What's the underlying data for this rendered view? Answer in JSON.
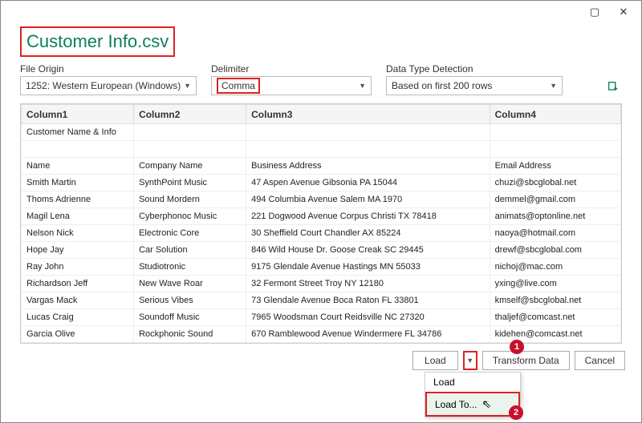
{
  "title": "Customer Info.csv",
  "controls": {
    "fileOrigin": {
      "label": "File Origin",
      "value": "1252: Western European (Windows)"
    },
    "delimiter": {
      "label": "Delimiter",
      "value": "Comma"
    },
    "detection": {
      "label": "Data Type Detection",
      "value": "Based on first 200 rows"
    }
  },
  "columns": [
    "Column1",
    "Column2",
    "Column3",
    "Column4"
  ],
  "rows": [
    [
      "Customer Name & Info",
      "",
      "",
      ""
    ],
    [
      "",
      "",
      "",
      ""
    ],
    [
      "Name",
      "Company Name",
      "Business Address",
      "Email Address"
    ],
    [
      "Smith Martin",
      "SynthPoint Music",
      "47 Aspen Avenue Gibsonia PA 15044",
      "chuzi@sbcglobal.net"
    ],
    [
      "Thoms Adrienne",
      "Sound Mordern",
      "494 Columbia Avenue Salem MA 1970",
      "demmel@gmail.com"
    ],
    [
      "Magil Lena",
      "Cyberphonoc Music",
      "221 Dogwood Avenue Corpus Christi TX 78418",
      "animats@optonline.net"
    ],
    [
      "Nelson Nick",
      "Electronic Core",
      "30 Sheffield Court Chandler AX 85224",
      "naoya@hotmail.com"
    ],
    [
      "Hope Jay",
      "Car Solution",
      "846 Wild House Dr. Goose Creak SC 29445",
      "drewf@sbcglobal.com"
    ],
    [
      "Ray John",
      "Studiotronic",
      "9175 Glendale Avenue Hastings MN 55033",
      "nichoj@mac.com"
    ],
    [
      "Richardson Jeff",
      "New Wave Roar",
      "32 Fermont Street Troy NY 12180",
      "yxing@live.com"
    ],
    [
      "Vargas Mack",
      "Serious Vibes",
      "73 Glendale Avenue Boca Raton FL 33801",
      "kmself@sbcglobal.net"
    ],
    [
      "Lucas Craig",
      "Soundoff Music",
      "7965 Woodsman Court Reidsville NC 27320",
      "thaljef@comcast.net"
    ],
    [
      "Garcia Olive",
      "Rockphonic Sound",
      "670 Ramblewood Avenue Windermere FL 34786",
      "kidehen@comcast.net"
    ]
  ],
  "buttons": {
    "load": "Load",
    "transform": "Transform Data",
    "cancel": "Cancel",
    "menuLoad": "Load",
    "menuLoadTo": "Load To..."
  },
  "badges": {
    "one": "1",
    "two": "2"
  }
}
